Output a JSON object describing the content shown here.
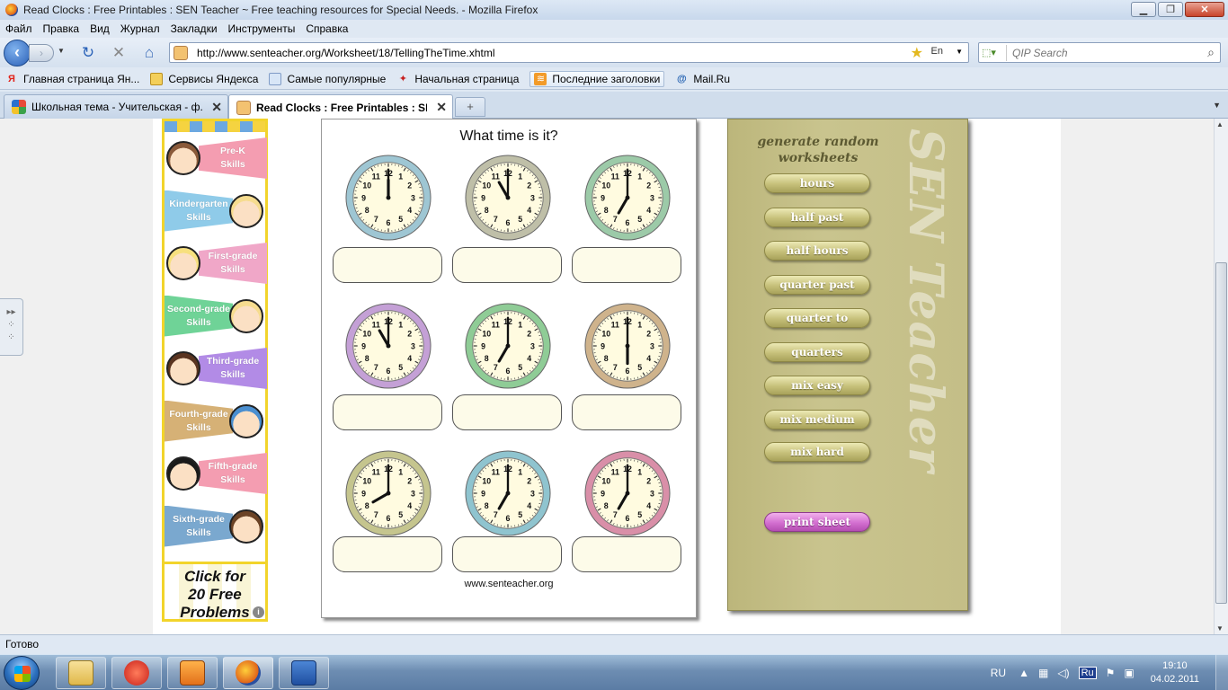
{
  "window": {
    "title": "Read Clocks : Free Printables : SEN Teacher ~ Free teaching resources for Special Needs. - Mozilla Firefox",
    "minimize": "▁",
    "maximize": "❐",
    "close": "✕"
  },
  "menu": [
    "Файл",
    "Правка",
    "Вид",
    "Журнал",
    "Закладки",
    "Инструменты",
    "Справка"
  ],
  "nav": {
    "url": "http://www.senteacher.org/Worksheet/18/TellingTheTime.xhtml",
    "search_placeholder": "QIP Search",
    "search_engine": "En"
  },
  "bookmarks": [
    {
      "label": "Главная страница Ян...",
      "icon": "yandex-icon"
    },
    {
      "label": "Сервисы Яндекса",
      "icon": "folder-icon"
    },
    {
      "label": "Самые популярные",
      "icon": "popular-icon"
    },
    {
      "label": "Начальная страница",
      "icon": "start-page-icon"
    },
    {
      "label": "Последние заголовки",
      "icon": "rss-icon"
    },
    {
      "label": "Mail.Ru",
      "icon": "at-icon"
    }
  ],
  "tabs": [
    {
      "title": "Школьная тема - Учительская - ф...",
      "active": false
    },
    {
      "title": "Read Clocks : Free Printables : SE...",
      "active": true
    }
  ],
  "ad": {
    "skills": [
      {
        "name": "Pre-K",
        "suffix": "Skills",
        "color": "#f49db1",
        "kid_side": "left",
        "kid_color": "#8a5a3a"
      },
      {
        "name": "Kindergarten",
        "suffix": "Skills",
        "color": "#8fcbe9",
        "kid_side": "right",
        "kid_color": "#f6dc8f"
      },
      {
        "name": "First-grade",
        "suffix": "Skills",
        "color": "#f0a7c8",
        "kid_side": "left",
        "kid_color": "#f7e07e"
      },
      {
        "name": "Second-grade",
        "suffix": "Skills",
        "color": "#6fd397",
        "kid_side": "right",
        "kid_color": "#f6dc8f"
      },
      {
        "name": "Third-grade",
        "suffix": "Skills",
        "color": "#b28be6",
        "kid_side": "left",
        "kid_color": "#5a3420"
      },
      {
        "name": "Fourth-grade",
        "suffix": "Skills",
        "color": "#d6b176",
        "kid_side": "right",
        "kid_color": "#4a8fd0"
      },
      {
        "name": "Fifth-grade",
        "suffix": "Skills",
        "color": "#f49db1",
        "kid_side": "left",
        "kid_color": "#1a1a1a"
      },
      {
        "name": "Sixth-grade",
        "suffix": "Skills",
        "color": "#7aa8cf",
        "kid_side": "right",
        "kid_color": "#6b4326"
      }
    ],
    "click_text": [
      "Click for",
      "20 Free",
      "Problems"
    ],
    "info": "i"
  },
  "worksheet": {
    "title": "What time is it?",
    "footer": "www.senteacher.org",
    "clocks": [
      {
        "hour": 12,
        "minute": 0,
        "rim": "#9ec6d3"
      },
      {
        "hour": 11,
        "minute": 0,
        "rim": "#bfbfa8"
      },
      {
        "hour": 7,
        "minute": 0,
        "rim": "#9ccaa8"
      },
      {
        "hour": 11,
        "minute": 0,
        "rim": "#c4a0d6"
      },
      {
        "hour": 7,
        "minute": 0,
        "rim": "#8fcc96"
      },
      {
        "hour": 6,
        "minute": 0,
        "rim": "#cfb38c"
      },
      {
        "hour": 8,
        "minute": 0,
        "rim": "#c5c58e"
      },
      {
        "hour": 7,
        "minute": 0,
        "rim": "#8fc4cf"
      },
      {
        "hour": 7,
        "minute": 0,
        "rim": "#d98fa8"
      }
    ],
    "clock_numbers": [
      "12",
      "1",
      "2",
      "3",
      "4",
      "5",
      "6",
      "7",
      "8",
      "9",
      "10",
      "11"
    ]
  },
  "panel": {
    "heading_line1": "generate random",
    "heading_line2": "worksheets",
    "brand": "SEN Teacher",
    "buttons": [
      "hours",
      "half past",
      "half hours",
      "quarter past",
      "quarter to",
      "quarters",
      "mix easy",
      "mix medium",
      "mix hard"
    ],
    "print": "print sheet"
  },
  "status": "Готово",
  "taskbar": {
    "lang": "RU",
    "keyboard": "Ru",
    "time": "19:10",
    "date": "04.02.2011"
  }
}
